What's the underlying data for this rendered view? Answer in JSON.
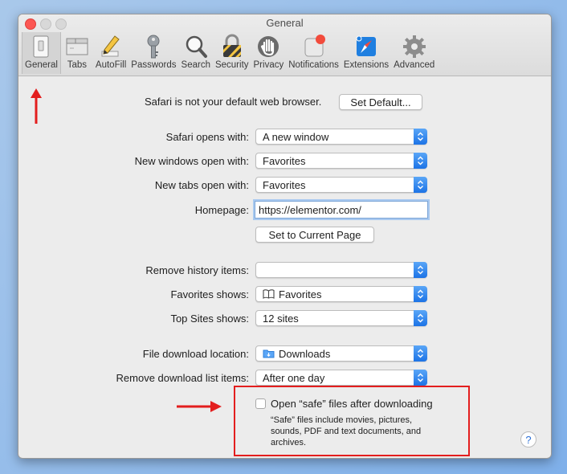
{
  "window": {
    "title": "General"
  },
  "toolbar": {
    "items": [
      {
        "label": "General",
        "icon": "general-switch-icon"
      },
      {
        "label": "Tabs",
        "icon": "tabs-icon"
      },
      {
        "label": "AutoFill",
        "icon": "pencil-icon"
      },
      {
        "label": "Passwords",
        "icon": "key-icon"
      },
      {
        "label": "Search",
        "icon": "magnifier-icon"
      },
      {
        "label": "Security",
        "icon": "padlock-icon"
      },
      {
        "label": "Privacy",
        "icon": "hand-icon"
      },
      {
        "label": "Notifications",
        "icon": "notification-badge-icon"
      },
      {
        "label": "Extensions",
        "icon": "puzzle-compass-icon"
      },
      {
        "label": "Advanced",
        "icon": "gear-icon"
      }
    ]
  },
  "default_browser": {
    "text": "Safari is not your default web browser.",
    "button": "Set Default..."
  },
  "settings": {
    "opens_with": {
      "label": "Safari opens with:",
      "value": "A new window"
    },
    "new_windows": {
      "label": "New windows open with:",
      "value": "Favorites"
    },
    "new_tabs": {
      "label": "New tabs open with:",
      "value": "Favorites"
    },
    "homepage": {
      "label": "Homepage:",
      "value": "https://elementor.com/"
    },
    "set_current_page": "Set to Current Page",
    "remove_history": {
      "label": "Remove history items:",
      "value": ""
    },
    "favorites_shows": {
      "label": "Favorites shows:",
      "value": "Favorites"
    },
    "top_sites": {
      "label": "Top Sites shows:",
      "value": "12 sites"
    },
    "download_location": {
      "label": "File download location:",
      "value": "Downloads"
    },
    "remove_download": {
      "label": "Remove download list items:",
      "value": "After one day"
    },
    "open_safe": {
      "label": "Open “safe” files after downloading",
      "note_line1": "“Safe” files include movies, pictures,",
      "note_line2": "sounds, PDF and text documents, and",
      "note_line3": "archives."
    },
    "help": "?"
  },
  "colors": {
    "accent": "#1c73e6",
    "annotation": "#e31e1e"
  }
}
